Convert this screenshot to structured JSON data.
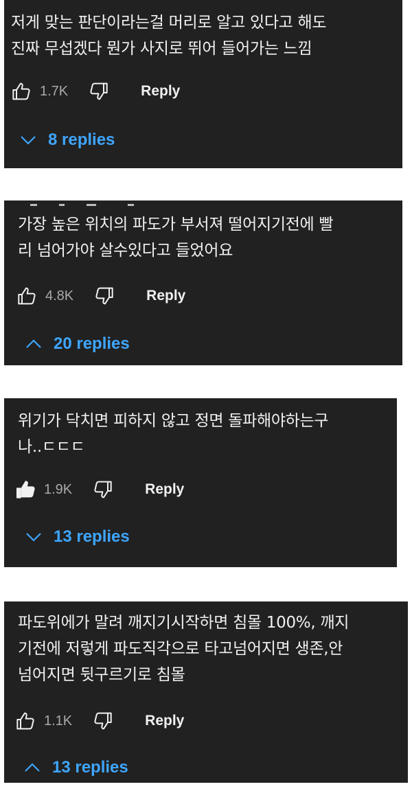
{
  "comments": [
    {
      "text": "저게 맞는 판단이라는걸 머리로 알고 있다고 해도\n진짜 무섭겠다 뭔가 사지로 뛰어 들어가는 느낌",
      "likes": "1.7K",
      "liked": false,
      "reply_label": "Reply",
      "replies_label": "8 replies",
      "replies_expanded": false
    },
    {
      "text": "가장 높은 위치의 파도가 부서져 떨어지기전에 빨\n리 넘어가야 살수있다고 들었어요",
      "likes": "4.8K",
      "liked": false,
      "reply_label": "Reply",
      "replies_label": "20 replies",
      "replies_expanded": true
    },
    {
      "text": "위기가 닥치면 피하지 않고 정면 돌파해야하는구\n나..ㄷㄷㄷ",
      "likes": "1.9K",
      "liked": true,
      "reply_label": "Reply",
      "replies_label": "13 replies",
      "replies_expanded": false
    },
    {
      "text": "파도위에가 말려 깨지기시작하면 침몰 100%, 깨지\n기전에 저렇게 파도직각으로 타고넘어지면 생존,안\n넘어지면 뒷구르기로 침몰",
      "likes": "1.1K",
      "liked": false,
      "reply_label": "Reply",
      "replies_label": "13 replies",
      "replies_expanded": true
    }
  ],
  "colors": {
    "card_bg": "#212121",
    "text": "#f1f1f1",
    "muted": "#aaaaaa",
    "link": "#3ea6ff"
  },
  "icons": [
    "thumb-up-icon",
    "thumb-down-icon",
    "chevron-down-icon",
    "chevron-up-icon"
  ]
}
